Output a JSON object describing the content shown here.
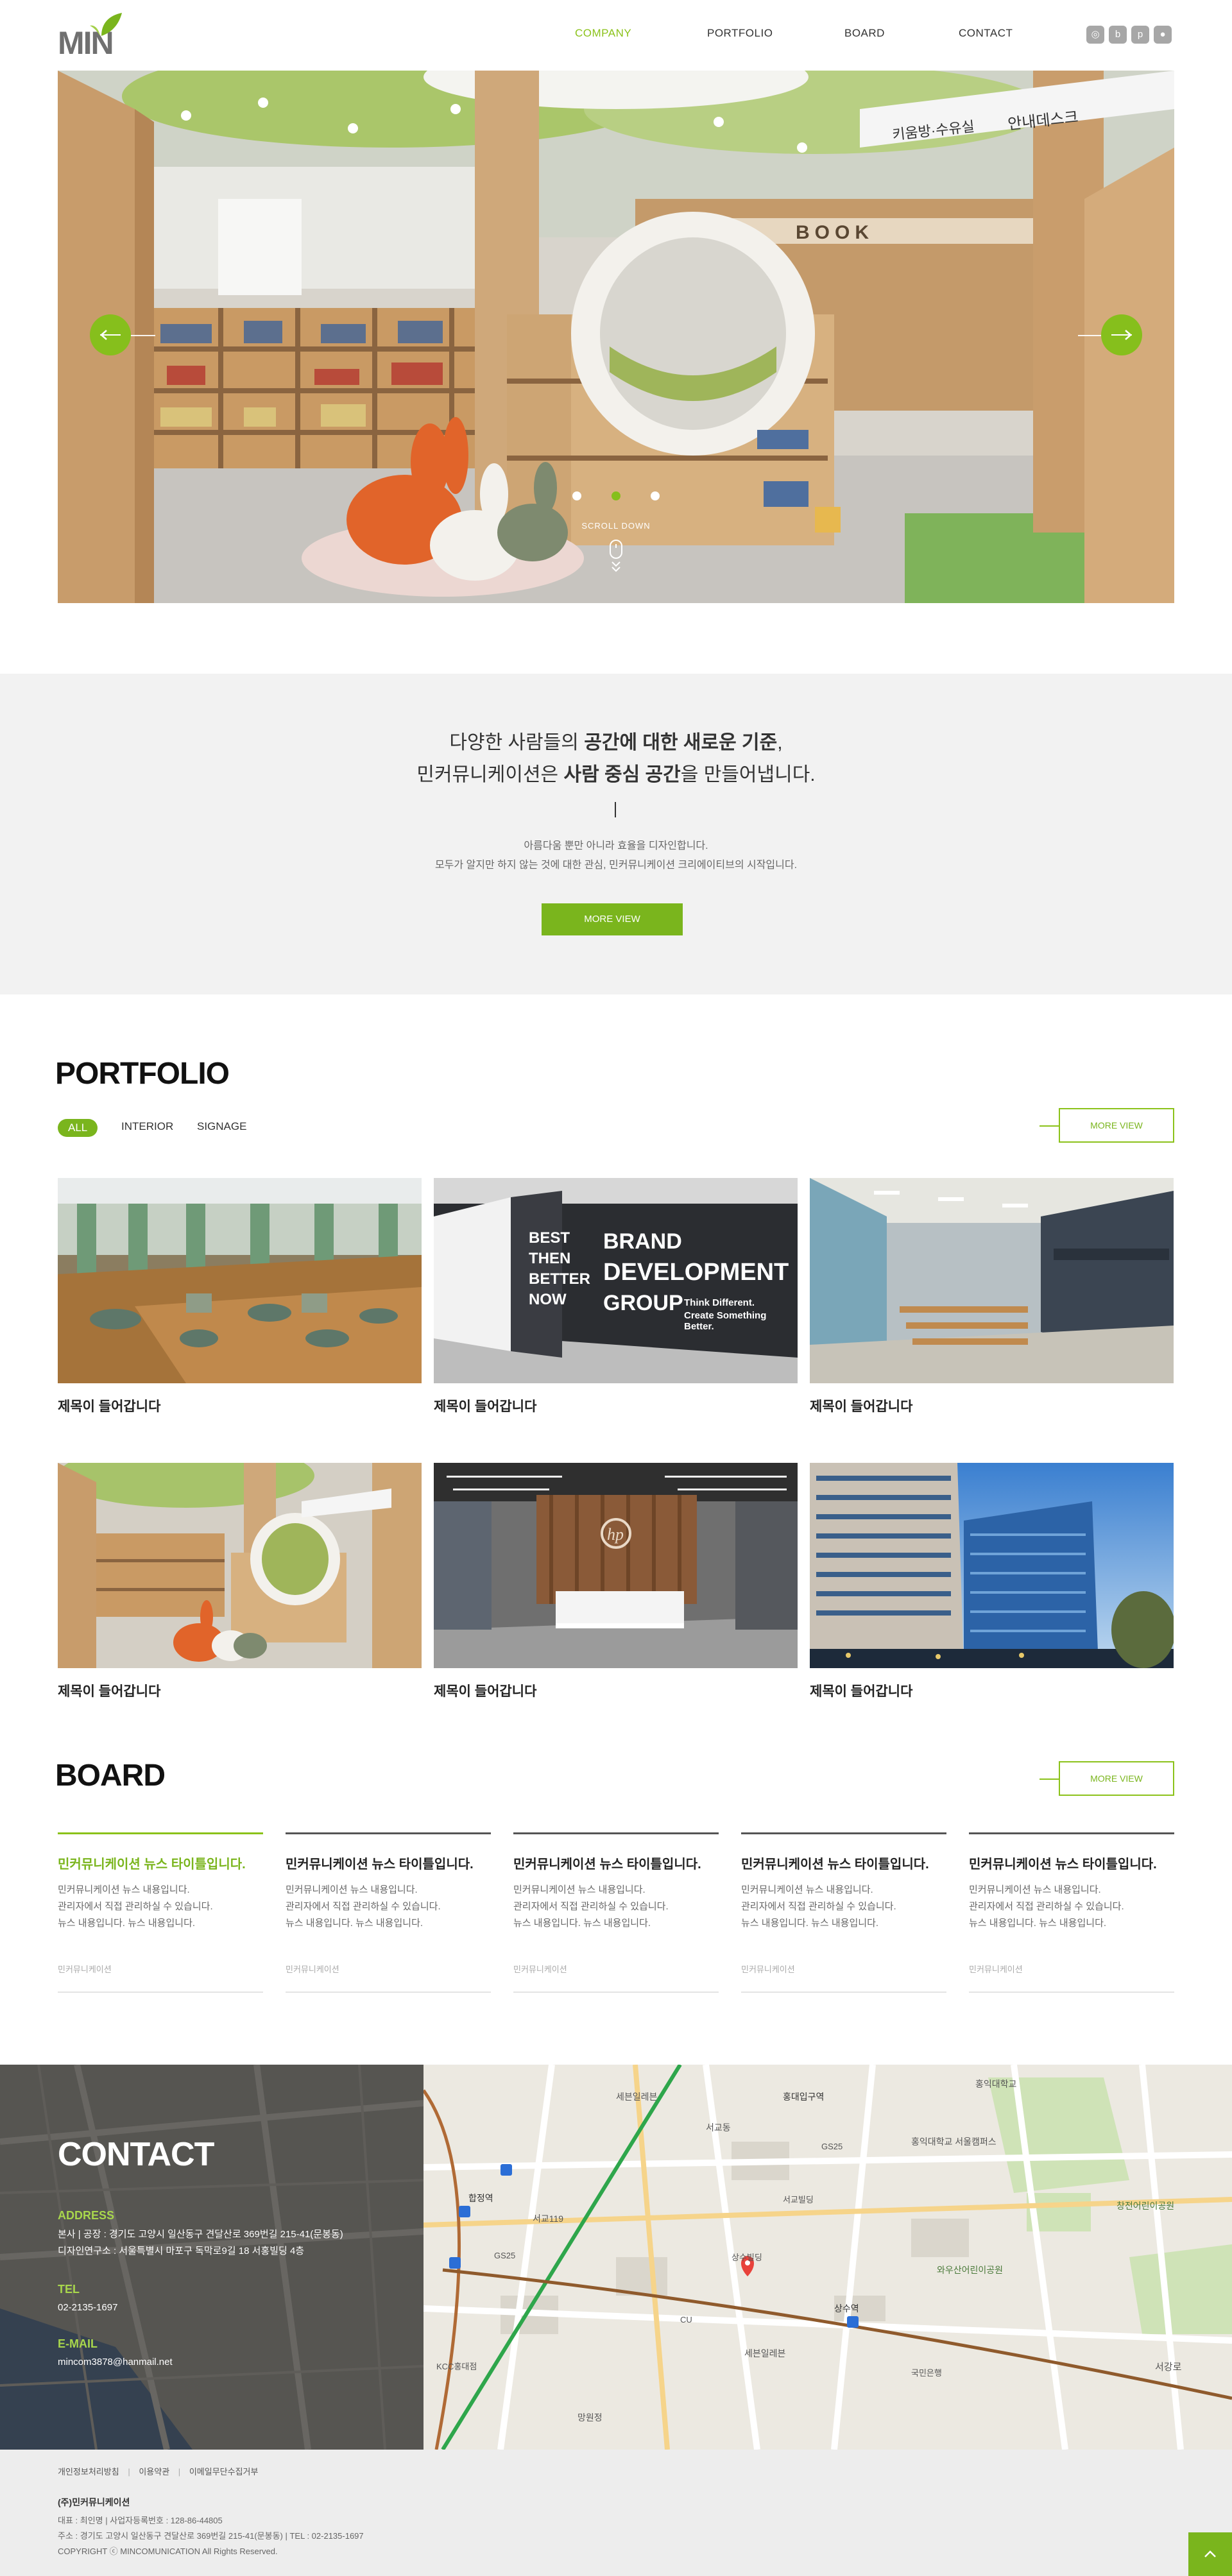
{
  "header": {
    "logo_text": "MIN",
    "nav": [
      "COMPANY",
      "PORTFOLIO",
      "BOARD",
      "CONTACT"
    ],
    "active_nav": "COMPANY",
    "sns_icons": [
      "instagram-icon",
      "blog-icon",
      "pinterest-icon",
      "kakao-icon"
    ]
  },
  "hero": {
    "sign_text_1": "키움방·수유실",
    "sign_text_2": "안내데스크",
    "book_text": "BOOK",
    "scroll_label": "SCROLL DOWN",
    "slides": 3,
    "active_slide": 2
  },
  "intro": {
    "line1_a": "다양한 사람들의 ",
    "line1_b": "공간에 대한 새로운 기준",
    "line1_c": ",",
    "line2_a": "민커뮤니케이션은 ",
    "line2_b": "사람 중심 공간",
    "line2_c": "을 만들어냅니다.",
    "sub1": "아름다움 뿐만 아니라 효율을 디자인합니다.",
    "sub2": "모두가 알지만 하지 않는 것에 대한 관심, 민커뮤니케이션 크리에이티브의 시작입니다.",
    "button": "MORE VIEW"
  },
  "portfolio": {
    "title": "PORTFOLIO",
    "tabs": [
      "ALL",
      "INTERIOR",
      "SIGNAGE"
    ],
    "more": "MORE VIEW",
    "brand_wall": {
      "big1": "BRAND",
      "big2": "DEVELOPMENT",
      "big3": "GROUP",
      "small1": "Think Different.",
      "small2": "Create Something Better.",
      "col1": "BEST",
      "col2": "THEN",
      "col3": "BETTER",
      "col4": "NOW"
    },
    "items": [
      {
        "caption": "제목이 들어갑니다"
      },
      {
        "caption": "제목이 들어갑니다"
      },
      {
        "caption": "제목이 들어갑니다"
      },
      {
        "caption": "제목이 들어갑니다"
      },
      {
        "caption": "제목이 들어갑니다"
      },
      {
        "caption": "제목이 들어갑니다"
      }
    ]
  },
  "board": {
    "title": "BOARD",
    "more": "MORE VIEW",
    "cards": [
      {
        "title": "민커뮤니케이션 뉴스 타이틀입니다.",
        "l1": "민커뮤니케이션 뉴스 내용입니다.",
        "l2": "관리자에서 직접 관리하실 수 있습니다.",
        "l3": "뉴스 내용입니다. 뉴스 내용입니다.",
        "meta": "민커뮤니케이션"
      },
      {
        "title": "민커뮤니케이션 뉴스 타이틀입니다.",
        "l1": "민커뮤니케이션 뉴스 내용입니다.",
        "l2": "관리자에서 직접 관리하실 수 있습니다.",
        "l3": "뉴스 내용입니다. 뉴스 내용입니다.",
        "meta": "민커뮤니케이션"
      },
      {
        "title": "민커뮤니케이션 뉴스 타이틀입니다.",
        "l1": "민커뮤니케이션 뉴스 내용입니다.",
        "l2": "관리자에서 직접 관리하실 수 있습니다.",
        "l3": "뉴스 내용입니다. 뉴스 내용입니다.",
        "meta": "민커뮤니케이션"
      },
      {
        "title": "민커뮤니케이션 뉴스 타이틀입니다.",
        "l1": "민커뮤니케이션 뉴스 내용입니다.",
        "l2": "관리자에서 직접 관리하실 수 있습니다.",
        "l3": "뉴스 내용입니다. 뉴스 내용입니다.",
        "meta": "민커뮤니케이션"
      },
      {
        "title": "민커뮤니케이션 뉴스 타이틀입니다.",
        "l1": "민커뮤니케이션 뉴스 내용입니다.",
        "l2": "관리자에서 직접 관리하실 수 있습니다.",
        "l3": "뉴스 내용입니다. 뉴스 내용입니다.",
        "meta": "민커뮤니케이션"
      }
    ]
  },
  "contact": {
    "title": "CONTACT",
    "address_label": "ADDRESS",
    "address_1": "본사 | 공장 : 경기도 고양시 일산동구 견달산로 369번길 215-41(문봉동)",
    "address_2": "디자인연구소 : 서울특별시 마포구 독막로9길 18 서홍빌딩 4층",
    "tel_label": "TEL",
    "tel": "02-2135-1697",
    "email_label": "E-MAIL",
    "email": "mincom3878@hanmail.net",
    "map_labels": [
      "세븐일레븐",
      "서교동",
      "합정역",
      "홍대입구역",
      "상수역",
      "서교119",
      "GS25",
      "CU",
      "세븐일레븐",
      "홍익대학교",
      "와우산어린이공원",
      "창전어린이공원",
      "서강로",
      "국민은행",
      "홍익대학교 서울캠퍼스",
      "망원정",
      "상수빌딩",
      "서교빌딩",
      "KCC홍대점",
      "GS25"
    ]
  },
  "footer": {
    "links": [
      "개인정보처리방침",
      "이용약관",
      "이메일무단수집거부"
    ],
    "company": "(주)민커뮤니케이션",
    "info1": "대표 : 최인명  |  사업자등록번호 : 128-86-44805",
    "info2": "주소 : 경기도 고양시 일산동구 견달산로 369번길 215-41(문봉동)  |  TEL : 02-2135-1697",
    "copyright": "COPYRIGHT ⓒ MINCOMUNICATION All Rights Reserved.",
    "top_icon": "arrow-up-icon"
  },
  "colors": {
    "accent": "#7ab51d",
    "accent_light": "#8bc21a",
    "intro_bg": "#f2f2f2",
    "footer_bg": "#ededed"
  }
}
